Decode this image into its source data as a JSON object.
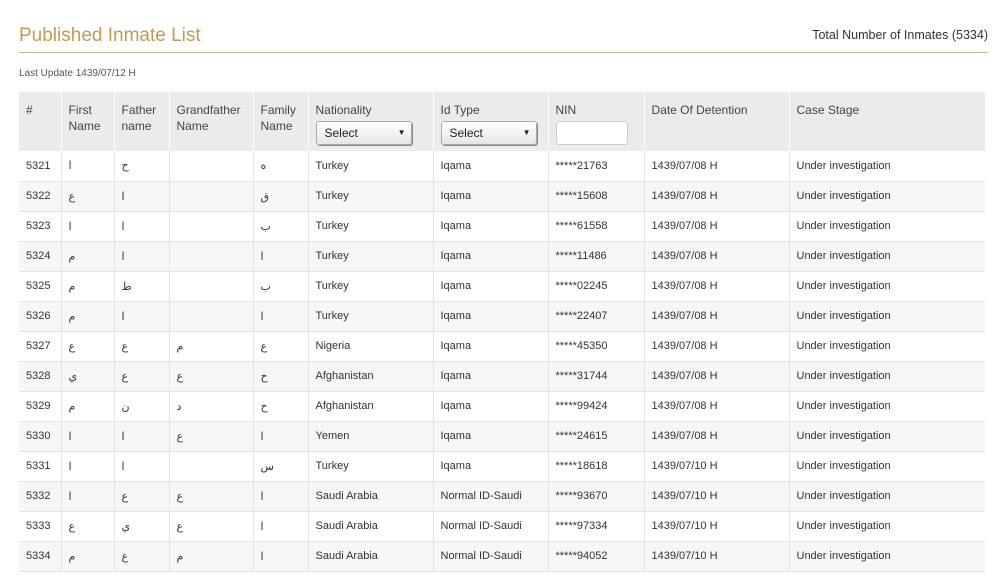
{
  "header": {
    "title": "Published Inmate List",
    "total": "Total Number of Inmates (5334)",
    "last_update": "Last Update 1439/07/12 H"
  },
  "columns": [
    "#",
    "First Name",
    "Father name",
    "Grandfather Name",
    "Family Name",
    "Nationality",
    "Id Type",
    "NIN",
    "Date Of Detention",
    "Case Stage"
  ],
  "filters": {
    "nationality_value": "Select",
    "idtype_value": "Select",
    "nin_value": ""
  },
  "rows": [
    [
      "5321",
      "ا",
      "ح",
      "",
      "ه",
      "Turkey",
      "Iqama",
      "*****21763",
      "1439/07/08 H",
      "Under investigation"
    ],
    [
      "5322",
      "ع",
      "ا",
      "",
      "ق",
      "Turkey",
      "Iqama",
      "*****15608",
      "1439/07/08 H",
      "Under investigation"
    ],
    [
      "5323",
      "ا",
      "ا",
      "",
      "ب",
      "Turkey",
      "Iqama",
      "*****61558",
      "1439/07/08 H",
      "Under investigation"
    ],
    [
      "5324",
      "م",
      "ا",
      "",
      "ا",
      "Turkey",
      "Iqama",
      "*****11486",
      "1439/07/08 H",
      "Under investigation"
    ],
    [
      "5325",
      "م",
      "ط",
      "",
      "ب",
      "Turkey",
      "Iqama",
      "*****02245",
      "1439/07/08 H",
      "Under investigation"
    ],
    [
      "5326",
      "م",
      "ا",
      "",
      "ا",
      "Turkey",
      "Iqama",
      "*****22407",
      "1439/07/08 H",
      "Under investigation"
    ],
    [
      "5327",
      "ع",
      "ع",
      "م",
      "ع",
      "Nigeria",
      "Iqama",
      "*****45350",
      "1439/07/08 H",
      "Under investigation"
    ],
    [
      "5328",
      "ي",
      "ع",
      "ع",
      "خ",
      "Afghanistan",
      "Iqama",
      "*****31744",
      "1439/07/08 H",
      "Under investigation"
    ],
    [
      "5329",
      "م",
      "ن",
      "د",
      "خ",
      "Afghanistan",
      "Iqama",
      "*****99424",
      "1439/07/08 H",
      "Under investigation"
    ],
    [
      "5330",
      "ا",
      "ا",
      "ع",
      "ا",
      "Yemen",
      "Iqama",
      "*****24615",
      "1439/07/08 H",
      "Under investigation"
    ],
    [
      "5331",
      "ا",
      "ا",
      "",
      "س",
      "Turkey",
      "Iqama",
      "*****18618",
      "1439/07/10 H",
      "Under investigation"
    ],
    [
      "5332",
      "ا",
      "ع",
      "ع",
      "ا",
      "Saudi Arabia",
      "Normal ID-Saudi",
      "*****93670",
      "1439/07/10 H",
      "Under investigation"
    ],
    [
      "5333",
      "ع",
      "ي",
      "ع",
      "ا",
      "Saudi Arabia",
      "Normal ID-Saudi",
      "*****97334",
      "1439/07/10 H",
      "Under investigation"
    ],
    [
      "5334",
      "م",
      "ع",
      "م",
      "ا",
      "Saudi Arabia",
      "Normal ID-Saudi",
      "*****94052",
      "1439/07/10 H",
      "Under investigation"
    ]
  ],
  "colors": {
    "title": "#c49a4e",
    "header_bg": "#ebebeb",
    "row_alt": "#f7f7f7"
  }
}
